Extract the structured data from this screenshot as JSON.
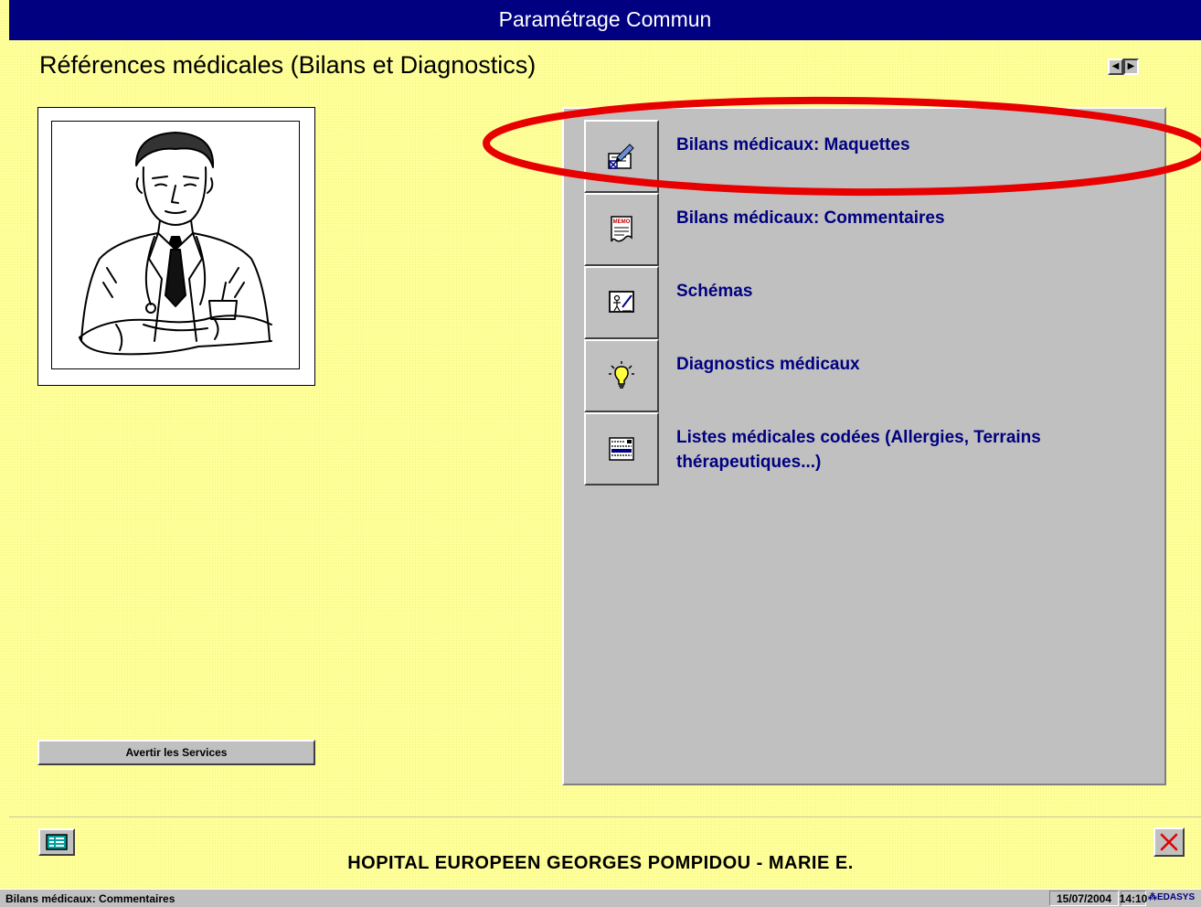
{
  "window": {
    "title": "Paramétrage Commun"
  },
  "page": {
    "heading": "Références médicales (Bilans et Diagnostics)"
  },
  "nav": {
    "prev_icon": "arrow-left-icon",
    "next_icon": "arrow-right-icon"
  },
  "left_panel": {
    "portrait_icon": "doctor-illustration",
    "notify_button_label": "Avertir les Services"
  },
  "menu": {
    "items": [
      {
        "label": "Bilans médicaux: Maquettes",
        "icon": "form-pen-icon",
        "highlighted": true
      },
      {
        "label": "Bilans médicaux: Commentaires",
        "icon": "memo-icon"
      },
      {
        "label": "Schémas",
        "icon": "diagram-figure-icon"
      },
      {
        "label": "Diagnostics médicaux",
        "icon": "lightbulb-icon"
      },
      {
        "label": "Listes médicales codées (Allergies, Terrains thérapeutiques...)",
        "icon": "coded-list-icon"
      }
    ],
    "highlight_color": "#e80000"
  },
  "footer": {
    "hospital_text": "HOPITAL EUROPEEN GEORGES POMPIDOU - MARIE E.",
    "list_icon": "list-view-icon",
    "close_icon": "close-icon"
  },
  "statusbar": {
    "message": "Bilans médicaux: Commentaires",
    "date": "15/07/2004",
    "time": "14:10",
    "brand": "EDASYS"
  },
  "colors": {
    "background": "#ffff99",
    "titlebar": "#000080",
    "panel": "#c0c0c0",
    "link": "#000080"
  }
}
